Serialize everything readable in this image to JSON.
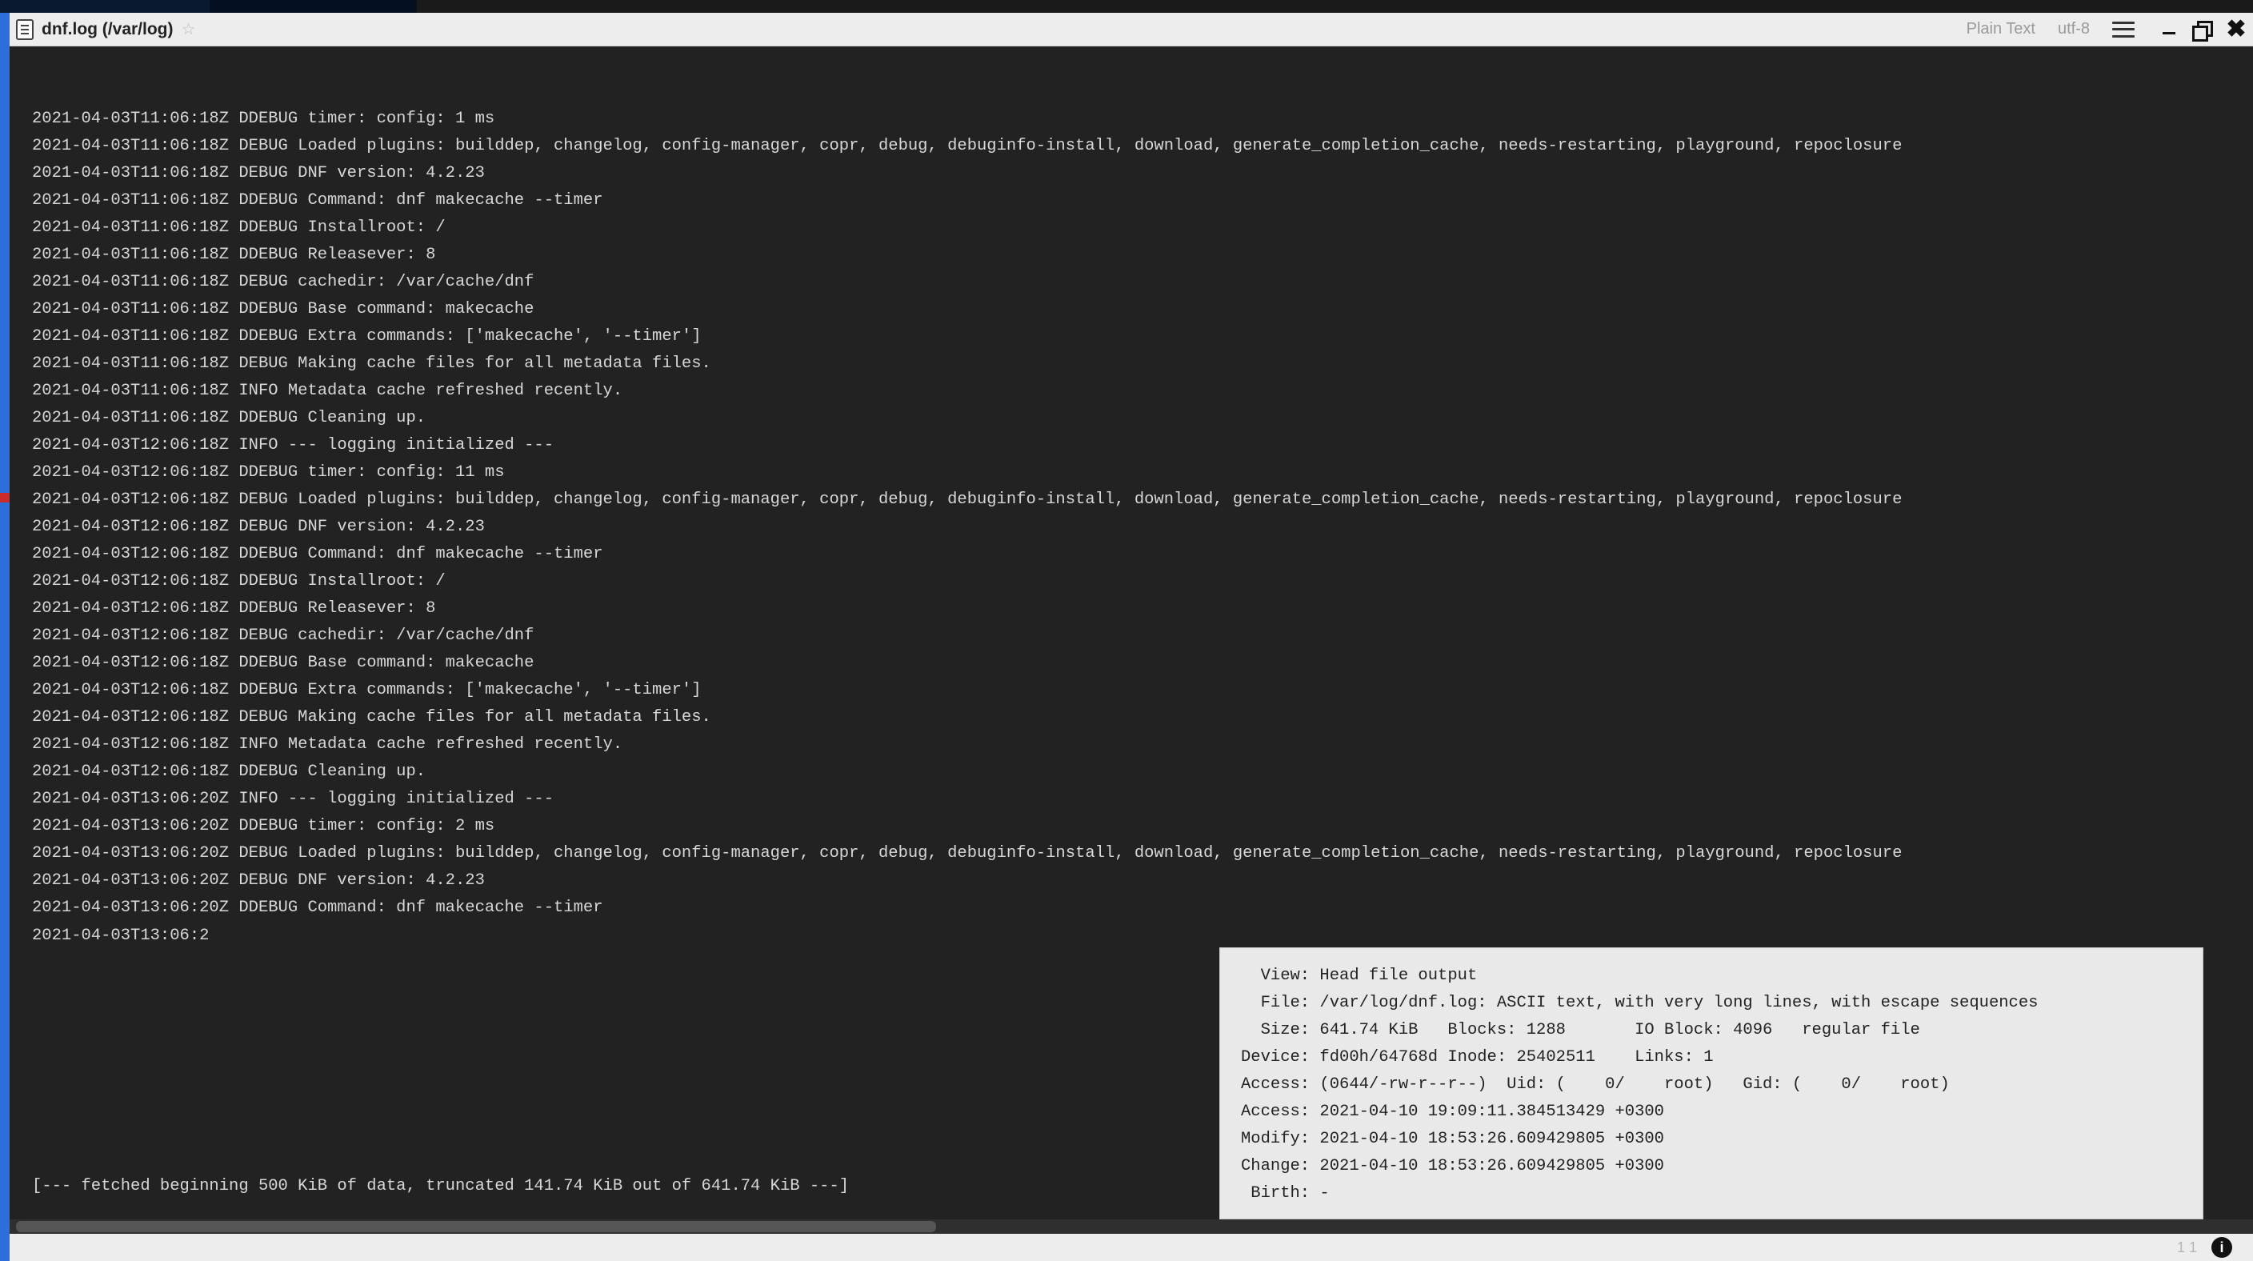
{
  "titlebar": {
    "filename": "dnf.log (/var/log)",
    "syntax_mode": "Plain Text",
    "encoding": "utf-8"
  },
  "log_lines": [
    "2021-04-03T11:06:18Z DDEBUG timer: config: 1 ms",
    "2021-04-03T11:06:18Z DEBUG Loaded plugins: builddep, changelog, config-manager, copr, debug, debuginfo-install, download, generate_completion_cache, needs-restarting, playground, repoclosure",
    "2021-04-03T11:06:18Z DEBUG DNF version: 4.2.23",
    "2021-04-03T11:06:18Z DDEBUG Command: dnf makecache --timer",
    "2021-04-03T11:06:18Z DDEBUG Installroot: /",
    "2021-04-03T11:06:18Z DDEBUG Releasever: 8",
    "2021-04-03T11:06:18Z DEBUG cachedir: /var/cache/dnf",
    "2021-04-03T11:06:18Z DDEBUG Base command: makecache",
    "2021-04-03T11:06:18Z DDEBUG Extra commands: ['makecache', '--timer']",
    "2021-04-03T11:06:18Z DEBUG Making cache files for all metadata files.",
    "2021-04-03T11:06:18Z INFO Metadata cache refreshed recently.",
    "2021-04-03T11:06:18Z DDEBUG Cleaning up.",
    "2021-04-03T12:06:18Z INFO --- logging initialized ---",
    "2021-04-03T12:06:18Z DDEBUG timer: config: 11 ms",
    "2021-04-03T12:06:18Z DEBUG Loaded plugins: builddep, changelog, config-manager, copr, debug, debuginfo-install, download, generate_completion_cache, needs-restarting, playground, repoclosure",
    "2021-04-03T12:06:18Z DEBUG DNF version: 4.2.23",
    "2021-04-03T12:06:18Z DDEBUG Command: dnf makecache --timer",
    "2021-04-03T12:06:18Z DDEBUG Installroot: /",
    "2021-04-03T12:06:18Z DDEBUG Releasever: 8",
    "2021-04-03T12:06:18Z DEBUG cachedir: /var/cache/dnf",
    "2021-04-03T12:06:18Z DDEBUG Base command: makecache",
    "2021-04-03T12:06:18Z DDEBUG Extra commands: ['makecache', '--timer']",
    "2021-04-03T12:06:18Z DEBUG Making cache files for all metadata files.",
    "2021-04-03T12:06:18Z INFO Metadata cache refreshed recently.",
    "2021-04-03T12:06:18Z DDEBUG Cleaning up.",
    "2021-04-03T13:06:20Z INFO --- logging initialized ---",
    "2021-04-03T13:06:20Z DDEBUG timer: config: 2 ms",
    "2021-04-03T13:06:20Z DEBUG Loaded plugins: builddep, changelog, config-manager, copr, debug, debuginfo-install, download, generate_completion_cache, needs-restarting, playground, repoclosure",
    "2021-04-03T13:06:20Z DEBUG DNF version: 4.2.23",
    "2021-04-03T13:06:20Z DDEBUG Command: dnf makecache --timer",
    "2021-04-03T13:06:2"
  ],
  "truncate_note": "[--- fetched beginning 500 KiB of data, truncated 141.74 KiB out of 641.74 KiB ---]",
  "stat_popup": {
    "lines": [
      "  View: Head file output",
      "  File: /var/log/dnf.log: ASCII text, with very long lines, with escape sequences",
      "  Size: 641.74 KiB   Blocks: 1288       IO Block: 4096   regular file",
      "Device: fd00h/64768d Inode: 25402511    Links: 1",
      "Access: (0644/-rw-r--r--)  Uid: (    0/    root)   Gid: (    0/    root)",
      "Access: 2021-04-10 19:09:11.384513429 +0300",
      "Modify: 2021-04-10 18:53:26.609429805 +0300",
      "Change: 2021-04-10 18:53:26.609429805 +0300",
      " Birth: -"
    ]
  },
  "statusbar": {
    "cursor": "1   1"
  }
}
